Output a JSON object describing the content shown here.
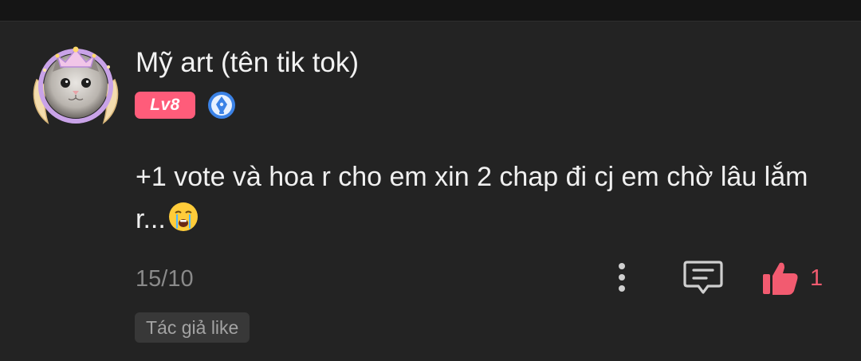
{
  "comment": {
    "username": "Mỹ art (tên tik tok)",
    "level_badge": "Lv8",
    "writer_badge_icon": "pen-nib-icon",
    "text": "+1 vote và hoa r cho em xin 2 chap đi cj em chờ lâu lắm r...",
    "emoji": "crying-face-emoji",
    "date": "15/10",
    "like_count": "1",
    "author_like_label": "Tác giả like"
  },
  "colors": {
    "background": "#232323",
    "username": "#f2f2f2",
    "level_badge": "#ff5c7a",
    "writer_badge": "#3b82e6",
    "like_active": "#f25b70",
    "meta_text": "#8a8a8a",
    "author_like_chip": "#383838"
  }
}
